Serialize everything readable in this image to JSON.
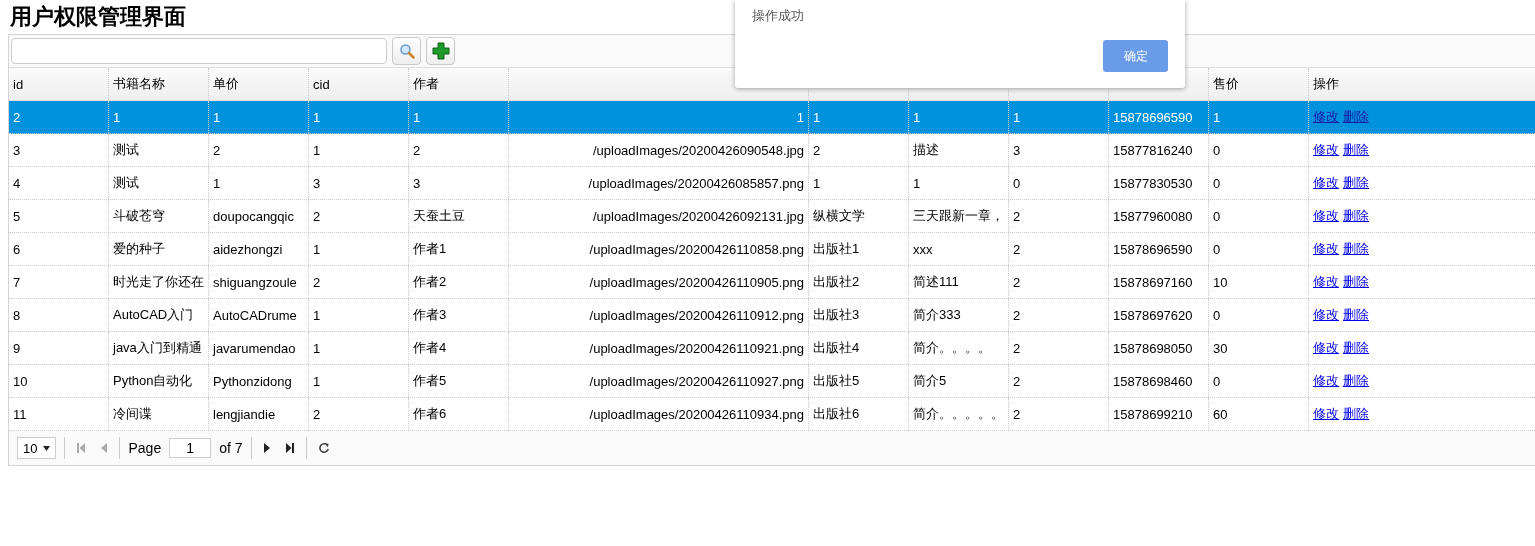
{
  "page_title": "用户权限管理界面",
  "table": {
    "columns": [
      {
        "label": "id",
        "kind": "text"
      },
      {
        "label": "书籍名称",
        "kind": "text"
      },
      {
        "label": "单价",
        "kind": "text"
      },
      {
        "label": "cid",
        "kind": "text"
      },
      {
        "label": "作者",
        "kind": "text"
      },
      {
        "kind": "path"
      },
      {
        "kind": "text"
      },
      {
        "kind": "text"
      },
      {
        "kind": "text"
      },
      {
        "kind": "text"
      },
      {
        "label": "售价",
        "kind": "text"
      },
      {
        "label": "操作",
        "kind": "actions"
      }
    ],
    "rows": [
      {
        "selected": true,
        "cells": [
          "2",
          "1",
          "1",
          "1",
          "1",
          "1",
          "1",
          "1",
          "1",
          "15878696590",
          "1"
        ],
        "actions": [
          "修改",
          "删除"
        ]
      },
      {
        "selected": false,
        "cells": [
          "3",
          "测试",
          "2",
          "1",
          "2",
          "/uploadImages/20200426090548.jpg",
          "2",
          "描述",
          "3",
          "15877816240",
          "0"
        ],
        "actions": [
          "修改",
          "删除"
        ]
      },
      {
        "selected": false,
        "cells": [
          "4",
          "测试",
          "1",
          "3",
          "3",
          "/uploadImages/20200426085857.png",
          "1",
          "1",
          "0",
          "15877830530",
          "0"
        ],
        "actions": [
          "修改",
          "删除"
        ]
      },
      {
        "selected": false,
        "cells": [
          "5",
          "斗破苍穹",
          "doupocangqic",
          "2",
          "天蚕土豆",
          "/uploadImages/20200426092131.jpg",
          "纵横文学",
          "三天跟新一章，",
          "2",
          "15877960080",
          "0"
        ],
        "actions": [
          "修改",
          "删除"
        ]
      },
      {
        "selected": false,
        "cells": [
          "6",
          "爱的种子",
          "aidezhongzi",
          "1",
          "作者1",
          "/uploadImages/20200426110858.png",
          "出版社1",
          "xxx",
          "2",
          "15878696590",
          "0"
        ],
        "actions": [
          "修改",
          "删除"
        ]
      },
      {
        "selected": false,
        "cells": [
          "7",
          "时光走了你还在",
          "shiguangzoule",
          "2",
          "作者2",
          "/uploadImages/20200426110905.png",
          "出版社2",
          "简述111",
          "2",
          "15878697160",
          "10"
        ],
        "actions": [
          "修改",
          "删除"
        ]
      },
      {
        "selected": false,
        "cells": [
          "8",
          "AutoCAD入门",
          "AutoCADrume",
          "1",
          "作者3",
          "/uploadImages/20200426110912.png",
          "出版社3",
          "简介333",
          "2",
          "15878697620",
          "0"
        ],
        "actions": [
          "修改",
          "删除"
        ]
      },
      {
        "selected": false,
        "cells": [
          "9",
          "java入门到精通",
          "javarumendao",
          "1",
          "作者4",
          "/uploadImages/20200426110921.png",
          "出版社4",
          "简介。。。。",
          "2",
          "15878698050",
          "30"
        ],
        "actions": [
          "修改",
          "删除"
        ]
      },
      {
        "selected": false,
        "cells": [
          "10",
          "Python自动化",
          "Pythonzidong",
          "1",
          "作者5",
          "/uploadImages/20200426110927.png",
          "出版社5",
          "简介5",
          "2",
          "15878698460",
          "0"
        ],
        "actions": [
          "修改",
          "删除"
        ]
      },
      {
        "selected": false,
        "cells": [
          "11",
          "冷间谍",
          "lengjiandie",
          "2",
          "作者6",
          "/uploadImages/20200426110934.png",
          "出版社6",
          "简介。。。。。",
          "2",
          "15878699210",
          "60"
        ],
        "actions": [
          "修改",
          "删除"
        ]
      }
    ]
  },
  "pager": {
    "page_size": "10",
    "page_label": "Page",
    "page": "1",
    "of_label": "of 7"
  },
  "dialog": {
    "message": "操作成功",
    "button": "确定"
  }
}
